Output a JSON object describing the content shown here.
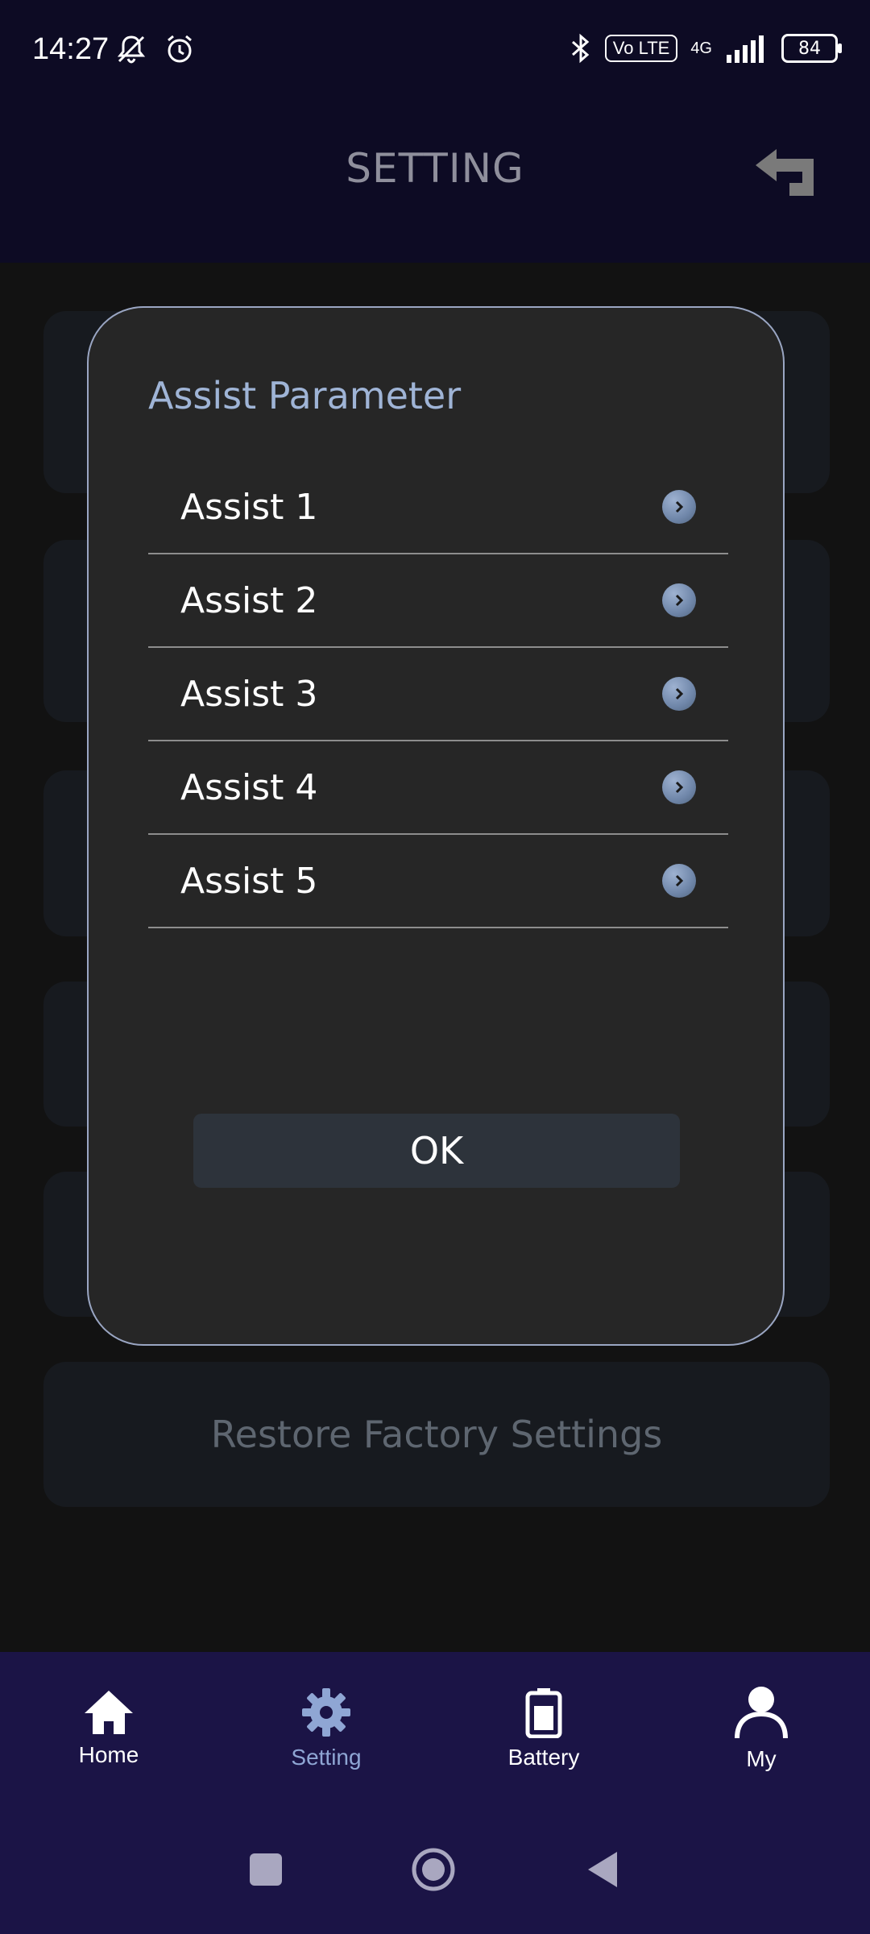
{
  "status_bar": {
    "time": "14:27",
    "volte": "Vo LTE",
    "network": "4G",
    "battery_level": "84"
  },
  "header": {
    "title": "SETTING"
  },
  "background": {
    "restore_label": "Restore Factory Settings"
  },
  "modal": {
    "title": "Assist Parameter",
    "items": [
      {
        "label": "Assist 1"
      },
      {
        "label": "Assist 2"
      },
      {
        "label": "Assist 3"
      },
      {
        "label": "Assist 4"
      },
      {
        "label": "Assist 5"
      }
    ],
    "ok_label": "OK"
  },
  "bottom_nav": {
    "items": [
      {
        "label": "Home",
        "icon": "home-icon"
      },
      {
        "label": "Setting",
        "icon": "gear-icon"
      },
      {
        "label": "Battery",
        "icon": "battery-icon"
      },
      {
        "label": "My",
        "icon": "user-icon"
      }
    ],
    "active_color": "#8fa6d4"
  },
  "colors": {
    "header_bg": "#0d0b24",
    "modal_bg": "#262626",
    "modal_border": "#9aa6c3",
    "nav_bg": "#1b1446",
    "title_accent": "#9fb4d6"
  }
}
